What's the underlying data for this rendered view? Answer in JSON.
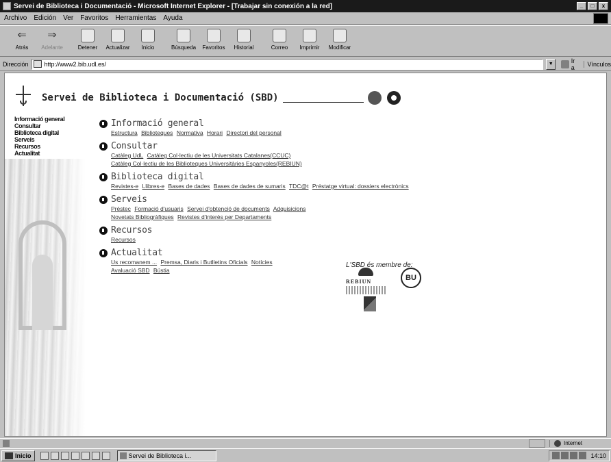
{
  "window": {
    "title": "Servei de Biblioteca i Documentació - Microsoft Internet Explorer - [Trabajar sin conexión a la red]",
    "buttons": [
      "_",
      "□",
      "x"
    ]
  },
  "menu": [
    "Archivo",
    "Edición",
    "Ver",
    "Favoritos",
    "Herramientas",
    "Ayuda"
  ],
  "toolbar": [
    {
      "label": "Atrás",
      "icon": "back-arrow-icon"
    },
    {
      "label": "Adelante",
      "icon": "forward-arrow-icon",
      "disabled": true
    },
    {
      "label": "Detener",
      "icon": "stop-icon"
    },
    {
      "label": "Actualizar",
      "icon": "refresh-icon"
    },
    {
      "label": "Inicio",
      "icon": "home-icon"
    },
    {
      "label": "Búsqueda",
      "icon": "search-icon"
    },
    {
      "label": "Favoritos",
      "icon": "favorites-icon"
    },
    {
      "label": "Historial",
      "icon": "history-icon"
    },
    {
      "label": "Correo",
      "icon": "mail-icon"
    },
    {
      "label": "Imprimir",
      "icon": "print-icon"
    },
    {
      "label": "Modificar",
      "icon": "edit-icon"
    }
  ],
  "address": {
    "label": "Dirección",
    "url": "http://www2.bib.udl.es/",
    "go": "Ir a",
    "links": "Vínculos"
  },
  "page": {
    "site_title": "Servei de Biblioteca i Documentació (SBD)",
    "sidebar": [
      "Informació general",
      "Consultar",
      "Biblioteca digital",
      "Serveis",
      "Recursos",
      "Actualitat"
    ],
    "sections": [
      {
        "title": "Informació general",
        "lines": [
          [
            "Estructura",
            "Biblioteques",
            "Normativa",
            "Horari",
            "Directori del personal"
          ]
        ]
      },
      {
        "title": "Consultar",
        "lines": [
          [
            "Catàleg UdL",
            "Catàleg Col·lectiu de les Universitats Catalanes(CCUC)"
          ],
          [
            "Catàleg Col·lectiu de les Biblioteques Universitàries Espanyoles(REBIUN)"
          ]
        ]
      },
      {
        "title": "Biblioteca digital",
        "lines": [
          [
            "Revistes-e",
            "Llibres-e",
            "Bases de dades",
            "Bases de dades de sumaris",
            "TDC@t",
            "Préstatge virtual: dossiers electrònics"
          ]
        ]
      },
      {
        "title": "Serveis",
        "lines": [
          [
            "Préstec",
            "Formació d'usuaris",
            "Servei d'obtenció de documents",
            "Adquisicions"
          ],
          [
            "Novetats Bibliogràfiques",
            "Revistes d'interès per Departaments"
          ]
        ]
      },
      {
        "title": "Recursos",
        "lines": [
          [
            "Recursos"
          ]
        ]
      },
      {
        "title": "Actualitat",
        "lines": [
          [
            "Us recomanem ...",
            "Premsa, Diaris i Butlletins Oficials",
            "Notícies"
          ],
          [
            "Avaluació SBD",
            "Bústia"
          ]
        ]
      }
    ],
    "member_text": "L'SBD és membre de:",
    "logos": {
      "rebiun": "REBIUN",
      "bu": "BU"
    }
  },
  "status": {
    "zone": "Internet"
  },
  "taskbar": {
    "start": "Inicio",
    "task": "Servei de Biblioteca i...",
    "clock": "14:10"
  }
}
